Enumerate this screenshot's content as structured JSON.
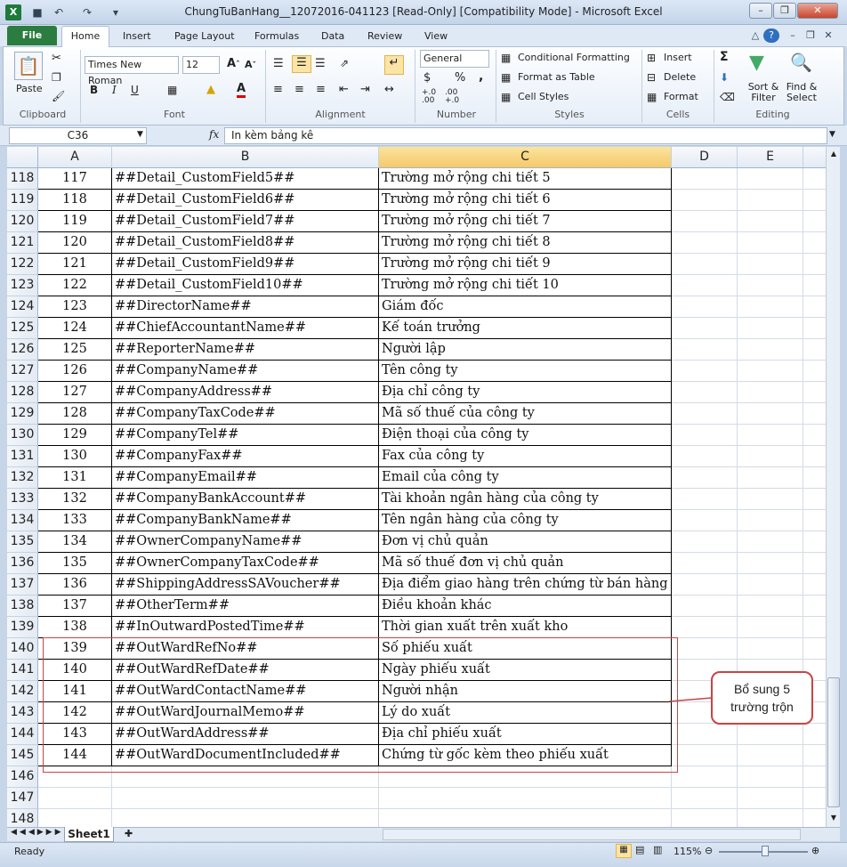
{
  "app": {
    "title": "ChungTuBanHang__12072016-041123  [Read-Only]  [Compatibility Mode]  -  Microsoft Excel"
  },
  "tabs": {
    "file": "File",
    "items": [
      "Home",
      "Insert",
      "Page Layout",
      "Formulas",
      "Data",
      "Review",
      "View"
    ]
  },
  "ribbon": {
    "clipboard": {
      "paste": "Paste",
      "label": "Clipboard"
    },
    "font": {
      "name": "Times New Roman",
      "size": "12",
      "bold": "B",
      "italic": "I",
      "underline": "U",
      "label": "Font"
    },
    "alignment": {
      "label": "Alignment"
    },
    "number": {
      "format": "General",
      "currency": "$",
      "percent": "%",
      "comma": ",",
      "inc_dec": "+.0 .00",
      "dec_dec": ".00 +.0",
      "label": "Number"
    },
    "styles": {
      "conditional": "Conditional Formatting",
      "table": "Format as Table",
      "cell_styles": "Cell Styles",
      "label": "Styles"
    },
    "cells": {
      "insert": "Insert",
      "delete": "Delete",
      "format": "Format",
      "label": "Cells"
    },
    "editing": {
      "sigma": "Σ",
      "sort": "Sort & Filter",
      "find": "Find & Select",
      "label": "Editing"
    }
  },
  "formula_bar": {
    "name_box": "C36",
    "fx": "fx",
    "value": "In kèm bảng kê"
  },
  "columns": [
    "A",
    "B",
    "C",
    "D",
    "E"
  ],
  "rows": [
    {
      "n": "118",
      "a": "117",
      "b": "##Detail_CustomField5##",
      "c": "Trường mở rộng chi tiết 5"
    },
    {
      "n": "119",
      "a": "118",
      "b": "##Detail_CustomField6##",
      "c": "Trường mở rộng chi tiết 6"
    },
    {
      "n": "120",
      "a": "119",
      "b": "##Detail_CustomField7##",
      "c": "Trường mở rộng chi tiết 7"
    },
    {
      "n": "121",
      "a": "120",
      "b": "##Detail_CustomField8##",
      "c": "Trường mở rộng chi tiết 8"
    },
    {
      "n": "122",
      "a": "121",
      "b": "##Detail_CustomField9##",
      "c": "Trường mở rộng chi tiết 9"
    },
    {
      "n": "123",
      "a": "122",
      "b": "##Detail_CustomField10##",
      "c": "Trường mở rộng chi tiết 10"
    },
    {
      "n": "124",
      "a": "123",
      "b": "##DirectorName##",
      "c": "Giám đốc"
    },
    {
      "n": "125",
      "a": "124",
      "b": "##ChiefAccountantName##",
      "c": "Kế toán trưởng"
    },
    {
      "n": "126",
      "a": "125",
      "b": "##ReporterName##",
      "c": "Người lập"
    },
    {
      "n": "127",
      "a": "126",
      "b": "##CompanyName##",
      "c": "Tên công ty"
    },
    {
      "n": "128",
      "a": "127",
      "b": "##CompanyAddress##",
      "c": "Địa chỉ công ty"
    },
    {
      "n": "129",
      "a": "128",
      "b": "##CompanyTaxCode##",
      "c": "Mã số thuế của công ty"
    },
    {
      "n": "130",
      "a": "129",
      "b": "##CompanyTel##",
      "c": "Điện thoại của công ty"
    },
    {
      "n": "131",
      "a": "130",
      "b": "##CompanyFax##",
      "c": "Fax của công ty"
    },
    {
      "n": "132",
      "a": "131",
      "b": "##CompanyEmail##",
      "c": "Email của công ty"
    },
    {
      "n": "133",
      "a": "132",
      "b": "##CompanyBankAccount##",
      "c": "Tài khoản ngân hàng của công ty"
    },
    {
      "n": "134",
      "a": "133",
      "b": "##CompanyBankName##",
      "c": "Tên ngân hàng của công ty"
    },
    {
      "n": "135",
      "a": "134",
      "b": "##OwnerCompanyName##",
      "c": "Đơn vị chủ quản"
    },
    {
      "n": "136",
      "a": "135",
      "b": "##OwnerCompanyTaxCode##",
      "c": "Mã số thuế đơn vị chủ quản"
    },
    {
      "n": "137",
      "a": "136",
      "b": "##ShippingAddressSAVoucher##",
      "c": "Địa điểm giao hàng trên chứng từ bán hàng"
    },
    {
      "n": "138",
      "a": "137",
      "b": "##OtherTerm##",
      "c": "Điều khoản khác"
    },
    {
      "n": "139",
      "a": "138",
      "b": "##InOutwardPostedTime##",
      "c": "Thời gian xuất trên xuất kho"
    },
    {
      "n": "140",
      "a": "139",
      "b": "##OutWardRefNo##",
      "c": "Số phiếu xuất"
    },
    {
      "n": "141",
      "a": "140",
      "b": "##OutWardRefDate##",
      "c": "Ngày phiếu xuất"
    },
    {
      "n": "142",
      "a": "141",
      "b": "##OutWardContactName##",
      "c": "Người nhận"
    },
    {
      "n": "143",
      "a": "142",
      "b": "##OutWardJournalMemo##",
      "c": "Lý do xuất"
    },
    {
      "n": "144",
      "a": "143",
      "b": "##OutWardAddress##",
      "c": "Địa chỉ phiếu xuất"
    },
    {
      "n": "145",
      "a": "144",
      "b": "##OutWardDocumentIncluded##",
      "c": "Chứng từ gốc kèm theo phiếu xuất"
    },
    {
      "n": "146",
      "a": "",
      "b": "",
      "c": ""
    },
    {
      "n": "147",
      "a": "",
      "b": "",
      "c": ""
    },
    {
      "n": "148",
      "a": "",
      "b": "",
      "c": ""
    }
  ],
  "callout": {
    "line1": "Bổ sung 5",
    "line2": "trường trộn"
  },
  "sheet": {
    "tab": "Sheet1"
  },
  "status": {
    "ready": "Ready",
    "zoom": "115%"
  },
  "colors": {
    "file_tab": "#2a7d3f",
    "callout_border": "#c94444"
  }
}
